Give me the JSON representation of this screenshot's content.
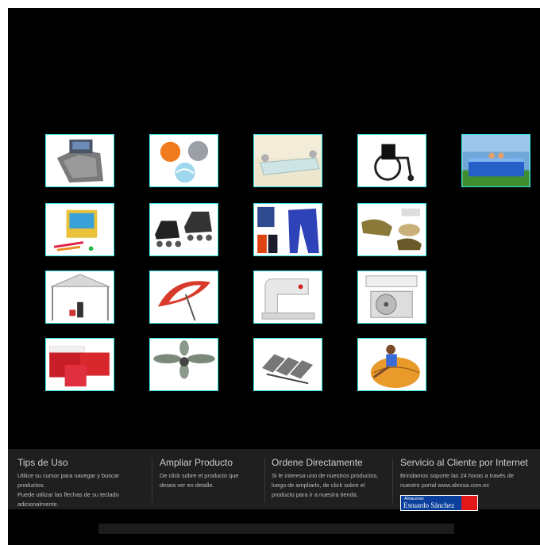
{
  "colors": {
    "stage": "#000000",
    "tile_border": "#2ee6e6",
    "footer": "#1f1f1f",
    "logo_blue": "#0a3f9c",
    "logo_red": "#e21818"
  },
  "products": [
    {
      "icon": "bath-mat-set-icon"
    },
    {
      "icon": "balls-icon"
    },
    {
      "icon": "glass-shelf-icon"
    },
    {
      "icon": "wheelchair-icon"
    },
    {
      "icon": "swimming-pool-icon"
    },
    {
      "icon": "toy-box-icon"
    },
    {
      "icon": "inline-skates-icon"
    },
    {
      "icon": "sportswear-icon"
    },
    {
      "icon": "sneakers-icon"
    },
    {
      "icon": "canopy-tent-icon"
    },
    {
      "icon": "beach-umbrella-icon"
    },
    {
      "icon": "sewing-machine-icon"
    },
    {
      "icon": "air-conditioner-icon"
    },
    {
      "icon": "coolers-icon"
    },
    {
      "icon": "ceiling-fan-icon"
    },
    {
      "icon": "waiting-chairs-icon"
    },
    {
      "icon": "bean-bag-icon"
    }
  ],
  "footer": {
    "tips_title": "Tips de Uso",
    "tips_line1": "Utilice su cursor para navegar y buscar",
    "tips_line2": "productos.",
    "tips_line3": "Puede utilizar las flechas de su teclado",
    "tips_line4": "adicionalmente.",
    "ampliar_title": "Ampliar Producto",
    "ampliar_line1": "De click sobre el producto que",
    "ampliar_line2": "desea ver en detalle.",
    "ordene_title": "Ordene Directamente",
    "ordene_line1": "Si le interesa uno de nuestros productos,",
    "ordene_line2": "luego de ampliarlo, de click sobre el",
    "ordene_line3": "producto para ir a nuestra tienda.",
    "servicio_title": "Servicio al Cliente por Internet",
    "servicio_line1": "Brindamos soporte las 24 horas a través de",
    "servicio_line2": "nuestro portal www.alessa.com.ec",
    "logo_small": "Almacenes",
    "logo_big": "Estuardo Sánchez"
  }
}
